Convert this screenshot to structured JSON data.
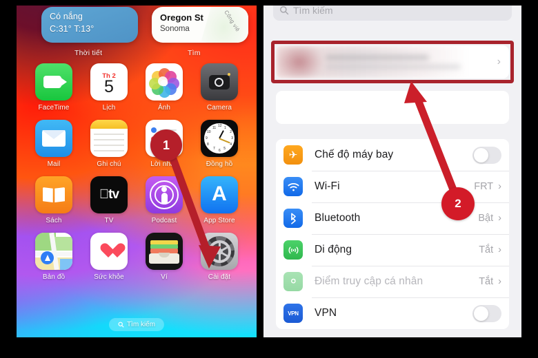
{
  "left_phone": {
    "widgets": [
      {
        "name": "weather",
        "line1": "Có nắng",
        "line2": "C:31° T:13°",
        "label": "Thời tiết"
      },
      {
        "name": "maps",
        "title": "Oregon St",
        "sub": "Sonoma",
        "streak_text": "Công viê",
        "label": "Tìm"
      }
    ],
    "apps": [
      {
        "name": "FaceTime",
        "icon": "facetime-icon"
      },
      {
        "name": "Lịch",
        "icon": "calendar-icon",
        "cal_month": "Th 2",
        "cal_day": "5"
      },
      {
        "name": "Ảnh",
        "icon": "photos-icon"
      },
      {
        "name": "Camera",
        "icon": "camera-icon"
      },
      {
        "name": "Mail",
        "icon": "mail-icon"
      },
      {
        "name": "Ghi chú",
        "icon": "notes-icon"
      },
      {
        "name": "Lời nhắc",
        "icon": "reminders-icon"
      },
      {
        "name": "Đồng hồ",
        "icon": "clock-icon"
      },
      {
        "name": "Sách",
        "icon": "books-icon"
      },
      {
        "name": "TV",
        "icon": "tv-icon",
        "glyph": "tv"
      },
      {
        "name": "Podcast",
        "icon": "podcast-icon"
      },
      {
        "name": "App Store",
        "icon": "appstore-icon",
        "glyph": "A"
      },
      {
        "name": "Bản đồ",
        "icon": "maps-icon"
      },
      {
        "name": "Sức khỏe",
        "icon": "health-icon"
      },
      {
        "name": "Ví",
        "icon": "wallet-icon"
      },
      {
        "name": "Cài đặt",
        "icon": "settings-gear-icon"
      }
    ],
    "dock_search": {
      "label": "Tìm kiếm",
      "icon": "search-icon"
    }
  },
  "right_phone": {
    "search": {
      "placeholder": "Tìm kiếm",
      "icon": "search-icon"
    },
    "apple_id_row": {
      "blurred": true,
      "chevron": "›"
    },
    "settings_rows": [
      {
        "label": "Chế độ máy bay",
        "icon": "airplane-icon",
        "control": "toggle",
        "toggle_on": false,
        "dim": false
      },
      {
        "label": "Wi-Fi",
        "icon": "wifi-icon",
        "control": "value",
        "value": "FRT",
        "chevron": "›",
        "dim": false
      },
      {
        "label": "Bluetooth",
        "icon": "bluetooth-icon",
        "control": "value",
        "value": "Bật",
        "chevron": "›",
        "dim": false
      },
      {
        "label": "Di động",
        "icon": "cellular-icon",
        "control": "value",
        "value": "Tắt",
        "chevron": "›",
        "dim": false
      },
      {
        "label": "Điểm truy cập cá nhân",
        "icon": "hotspot-icon",
        "control": "value",
        "value": "Tắt",
        "chevron": "›",
        "dim": true
      },
      {
        "label": "VPN",
        "icon": "vpn-icon",
        "control": "toggle",
        "toggle_on": false,
        "dim": false,
        "glyph": "VPN"
      }
    ]
  },
  "annotations": {
    "step_badges": [
      {
        "number": "1",
        "color": "#b51f2a",
        "points_to": "Cài đặt app icon"
      },
      {
        "number": "2",
        "color": "#d31b28",
        "points_to": "Apple ID row"
      }
    ],
    "highlight_box": {
      "color": "#a8232c",
      "target": "Apple ID row"
    }
  },
  "colors": {
    "annotation_red": "#a8232c",
    "badge_1": "#b51f2a",
    "badge_2": "#d31b28",
    "ios_blue": "#1169e8",
    "ios_green": "#2fb84e",
    "ios_orange": "#f2900e"
  }
}
